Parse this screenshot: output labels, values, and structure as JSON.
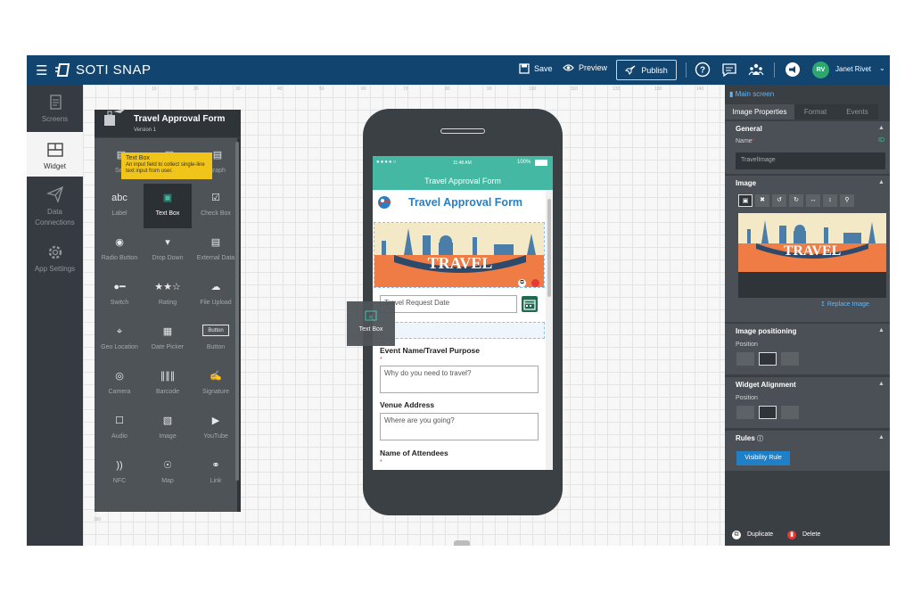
{
  "app": {
    "brand": "SOTI SNAP"
  },
  "topbar": {
    "save": "Save",
    "preview": "Preview",
    "publish": "Publish",
    "user_initials": "RV",
    "user_name": "Janet Rivet"
  },
  "leftnav": [
    {
      "label": "Screens",
      "icon": "screens-icon"
    },
    {
      "label": "Widget",
      "icon": "widget-icon",
      "active": true
    },
    {
      "label": "Data Connections",
      "icon": "send-icon"
    },
    {
      "label": "App Settings",
      "icon": "gear-icon"
    }
  ],
  "rulers": [
    "10",
    "20",
    "30",
    "40",
    "50",
    "60",
    "70",
    "80",
    "90",
    "100",
    "110",
    "120",
    "130",
    "140",
    "150"
  ],
  "ruler_bottom": "180",
  "palette": {
    "title": "Travel Approval Form",
    "version": "Version 1",
    "tooltip_title": "Text Box",
    "tooltip_text": "An input field to collect single-line text input from user.",
    "row0": [
      "Sect",
      "",
      "graph"
    ],
    "items": [
      {
        "label": "Label",
        "icon": "abc"
      },
      {
        "label": "Text Box",
        "icon": "textbox"
      },
      {
        "label": "Check Box",
        "icon": "checkbox"
      },
      {
        "label": "Radio Button",
        "icon": "radio"
      },
      {
        "label": "Drop Down",
        "icon": "dropdown"
      },
      {
        "label": "External Data",
        "icon": "extdata"
      },
      {
        "label": "Switch",
        "icon": "switch"
      },
      {
        "label": "Rating",
        "icon": "rating"
      },
      {
        "label": "File Upload",
        "icon": "upload"
      },
      {
        "label": "Geo Location",
        "icon": "pin"
      },
      {
        "label": "Date Picker",
        "icon": "calendar"
      },
      {
        "label": "Button",
        "icon": "button"
      },
      {
        "label": "Camera",
        "icon": "camera"
      },
      {
        "label": "Barcode",
        "icon": "barcode"
      },
      {
        "label": "Signature",
        "icon": "signature"
      },
      {
        "label": "Audio",
        "icon": "mic"
      },
      {
        "label": "Image",
        "icon": "image"
      },
      {
        "label": "YouTube",
        "icon": "youtube"
      },
      {
        "label": "NFC",
        "icon": "nfc"
      },
      {
        "label": "Map",
        "icon": "map"
      },
      {
        "label": "Link",
        "icon": "link"
      }
    ],
    "button_glyph": "Button",
    "abc_glyph": "abc"
  },
  "phone": {
    "status_time": "11:48 AM",
    "status_battery": "100%",
    "app_title": "Travel Approval Form",
    "form_title": "Travel Approval Form",
    "banner_text": "TRAVEL",
    "date_placeholder": "Travel Request Date",
    "event_label": "Event Name/Travel Purpose",
    "event_placeholder": "Why do you need to travel?",
    "venue_label": "Venue Address",
    "venue_placeholder": "Where are you going?",
    "attendees_label": "Name of Attendees",
    "req_mark": "*"
  },
  "dragtile": {
    "label": "Text Box"
  },
  "rpanel": {
    "crumb": "Main screen",
    "tabs": [
      "Image Properties",
      "Format",
      "Events"
    ],
    "general": "General",
    "name_label": "Name",
    "id_label": "ID",
    "name_value": "TravelImage",
    "image": "Image",
    "replace": "Replace Image",
    "banner_text": "TRAVEL",
    "positioning": "Image positioning",
    "position": "Position",
    "alignment": "Widget Alignment",
    "rules": "Rules",
    "visibility": "Visibility Rule",
    "duplicate": "Duplicate",
    "delete": "Delete"
  }
}
